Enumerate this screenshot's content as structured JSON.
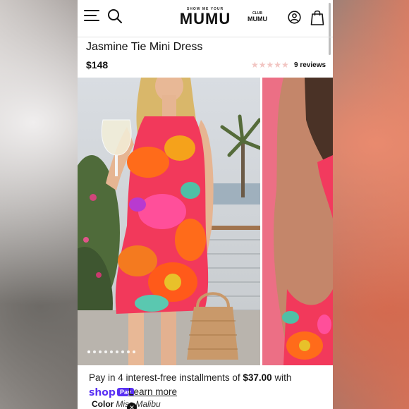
{
  "header": {
    "logo_tagline": "SHOW ME YOUR",
    "logo_name": "MUMU",
    "club_line1": "CLUB",
    "club_line2": "MUMU",
    "icons": [
      "menu-icon",
      "search-icon",
      "account-icon",
      "shopping-bag-icon"
    ]
  },
  "product": {
    "title": "Jasmine Tie Mini Dress",
    "price": "$148",
    "rating_stars": "★★★★★",
    "reviews_label": "9 reviews"
  },
  "gallery": {
    "image_count": 9,
    "active_index": 0,
    "images": [
      {
        "alt": "Model wearing floral halter mini dress holding wine glass and woven bag"
      },
      {
        "alt": "Back view of floral tie mini dress on pink background"
      }
    ]
  },
  "payment": {
    "installments_prefix": "Pay in 4 interest-free installments of",
    "installment_amount": "$37.00",
    "installments_suffix": "with",
    "shop_word": "shop",
    "pay_badge": "Pay",
    "learn_more": "Learn more"
  },
  "options": {
    "color_label": "Color",
    "color_value": "Miss Malibu"
  },
  "colors": {
    "shop_pay_purple": "#5a31f4",
    "star_empty": "#f2c6c3"
  }
}
